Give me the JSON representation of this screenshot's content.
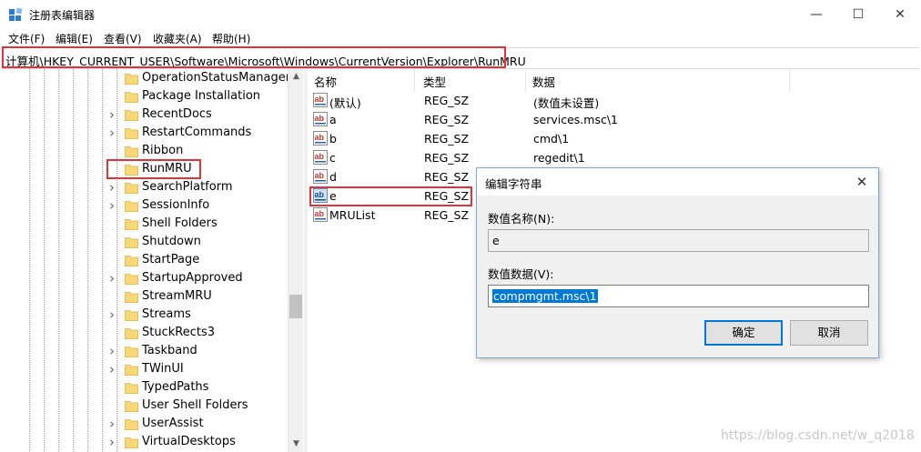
{
  "window": {
    "title": "注册表编辑器",
    "controls": {
      "minimize": "—",
      "maximize": "☐",
      "close": "✕"
    }
  },
  "menu": {
    "items": [
      {
        "label": "文件(F)"
      },
      {
        "label": "编辑(E)"
      },
      {
        "label": "查看(V)"
      },
      {
        "label": "收藏夹(A)"
      },
      {
        "label": "帮助(H)"
      }
    ]
  },
  "address": {
    "path": "计算机\\HKEY_CURRENT_USER\\Software\\Microsoft\\Windows\\CurrentVersion\\Explorer\\RunMRU"
  },
  "tree": {
    "items": [
      {
        "label": "OperationStatusManager",
        "expandable": false
      },
      {
        "label": "Package Installation",
        "expandable": false
      },
      {
        "label": "RecentDocs",
        "expandable": true
      },
      {
        "label": "RestartCommands",
        "expandable": true
      },
      {
        "label": "Ribbon",
        "expandable": false
      },
      {
        "label": "RunMRU",
        "expandable": false,
        "highlighted": true
      },
      {
        "label": "SearchPlatform",
        "expandable": true
      },
      {
        "label": "SessionInfo",
        "expandable": true
      },
      {
        "label": "Shell Folders",
        "expandable": false
      },
      {
        "label": "Shutdown",
        "expandable": false
      },
      {
        "label": "StartPage",
        "expandable": false
      },
      {
        "label": "StartupApproved",
        "expandable": true
      },
      {
        "label": "StreamMRU",
        "expandable": false
      },
      {
        "label": "Streams",
        "expandable": true
      },
      {
        "label": "StuckRects3",
        "expandable": false
      },
      {
        "label": "Taskband",
        "expandable": true
      },
      {
        "label": "TWinUI",
        "expandable": true
      },
      {
        "label": "TypedPaths",
        "expandable": false
      },
      {
        "label": "User Shell Folders",
        "expandable": false
      },
      {
        "label": "UserAssist",
        "expandable": true
      },
      {
        "label": "VirtualDesktops",
        "expandable": true
      }
    ]
  },
  "list": {
    "columns": {
      "name": "名称",
      "type": "类型",
      "data": "数据"
    },
    "rows": [
      {
        "name": "(默认)",
        "type": "REG_SZ",
        "data": "(数值未设置)"
      },
      {
        "name": "a",
        "type": "REG_SZ",
        "data": "services.msc\\1"
      },
      {
        "name": "b",
        "type": "REG_SZ",
        "data": "cmd\\1"
      },
      {
        "name": "c",
        "type": "REG_SZ",
        "data": "regedit\\1"
      },
      {
        "name": "d",
        "type": "REG_SZ",
        "data": ""
      },
      {
        "name": "e",
        "type": "REG_SZ",
        "data": "",
        "selected": true
      },
      {
        "name": "MRUList",
        "type": "REG_SZ",
        "data": ""
      }
    ]
  },
  "dialog": {
    "title": "编辑字符串",
    "name_label": "数值名称(N):",
    "name_value": "e",
    "data_label": "数值数据(V):",
    "data_value": "compmgmt.msc\\1",
    "ok_label": "确定",
    "cancel_label": "取消",
    "close_glyph": "✕"
  },
  "watermark": "https://blog.csdn.net/w_q2018",
  "colors": {
    "highlight_box": "#e53238",
    "selection": "#0078d7",
    "folder": "#f8d775"
  },
  "icons": {
    "app": "registry-editor-icon",
    "folder": "folder-icon",
    "string_value": "reg-sz-icon",
    "expand": "chevron-right-icon"
  }
}
